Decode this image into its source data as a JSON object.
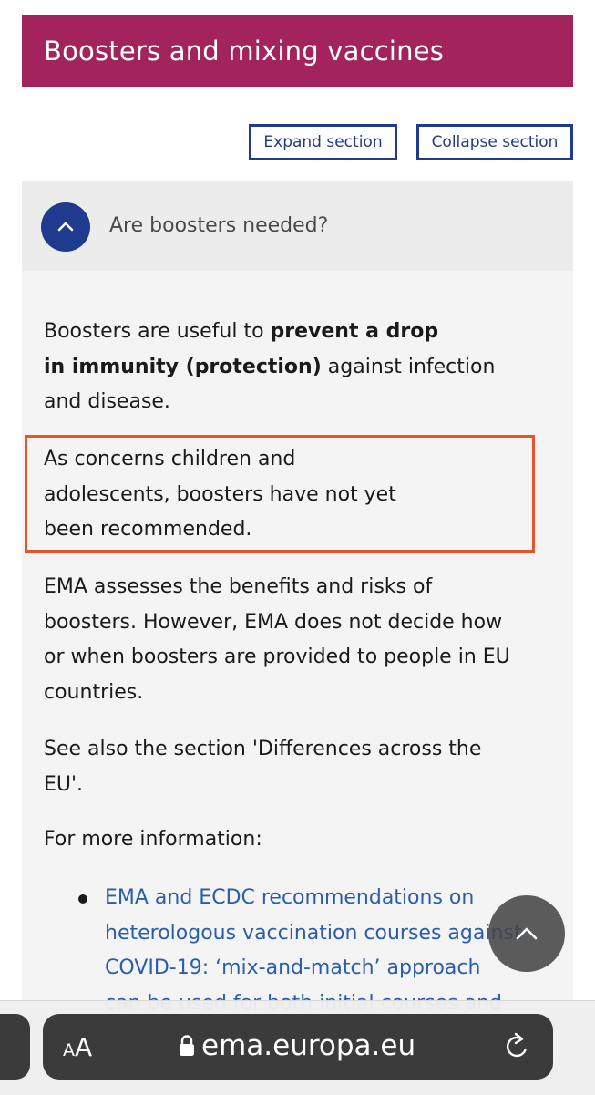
{
  "section": {
    "title": "Boosters and mixing vaccines",
    "expand_label": "Expand section",
    "collapse_label": "Collapse section"
  },
  "accordion": {
    "question": "Are boosters needed?",
    "toggle_icon": "chevron-up-icon"
  },
  "content": {
    "p1": {
      "l1_pre": "Boosters are useful to ",
      "l1_bold": "prevent a drop",
      "l2_bold": "in immunity (protection)",
      "l2_post": " against infection",
      "l3": "and disease."
    },
    "p2": {
      "l1": "As concerns children and",
      "l2": "adolescents, boosters have not yet",
      "l3": "been recommended."
    },
    "p3": {
      "l1": "EMA assesses the benefits and risks of",
      "l2": "boosters. However, EMA does not decide how",
      "l3": "or when boosters are provided to people in EU",
      "l4": "countries."
    },
    "p4": {
      "l1": "See also the section 'Differences across the",
      "l2": "EU'."
    },
    "p5": "For more information:",
    "link": {
      "l1": "EMA and ECDC recommendations on",
      "l2": "heterologous vaccination courses against",
      "l3": "COVID-19: ‘mix-and-match’ approach",
      "l4": "can be used for both initial courses and"
    }
  },
  "highlight_color": "#e4562a",
  "brand_color": "#a3235c",
  "accent_color": "#1f3b8f",
  "browser": {
    "aa_label_small": "A",
    "aa_label_large": "A",
    "url": "ema.europa.eu",
    "lock_icon": "lock-icon",
    "reload_icon": "reload-icon"
  }
}
